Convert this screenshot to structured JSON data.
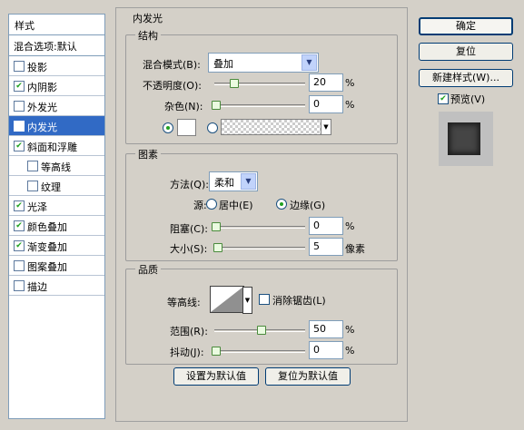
{
  "sidebar": {
    "header": "样式",
    "blend": "混合选项:默认",
    "items": [
      {
        "label": "投影",
        "checked": false,
        "selected": false
      },
      {
        "label": "内阴影",
        "checked": true,
        "selected": false
      },
      {
        "label": "外发光",
        "checked": false,
        "selected": false
      },
      {
        "label": "内发光",
        "checked": true,
        "selected": true
      },
      {
        "label": "斜面和浮雕",
        "checked": true,
        "selected": false
      },
      {
        "label": "等高线",
        "checked": false,
        "selected": false
      },
      {
        "label": "纹理",
        "checked": false,
        "selected": false
      },
      {
        "label": "光泽",
        "checked": true,
        "selected": false
      },
      {
        "label": "颜色叠加",
        "checked": true,
        "selected": false
      },
      {
        "label": "渐变叠加",
        "checked": true,
        "selected": false
      },
      {
        "label": "图案叠加",
        "checked": false,
        "selected": false
      },
      {
        "label": "描边",
        "checked": false,
        "selected": false
      }
    ]
  },
  "main": {
    "title": "内发光",
    "structure": {
      "title": "结构",
      "blend_mode_label": "混合模式(B):",
      "blend_mode_value": "叠加",
      "opacity_label": "不透明度(O):",
      "opacity_value": "20",
      "opacity_fraction": 0.2,
      "noise_label": "杂色(N):",
      "noise_value": "0",
      "noise_fraction": 0.0,
      "unit": "%"
    },
    "elements": {
      "title": "图素",
      "method_label": "方法(Q):",
      "method_value": "柔和",
      "source_label": "源:",
      "source_center": "居中(E)",
      "source_edge": "边缘(G)",
      "choke_label": "阻塞(C):",
      "choke_value": "0",
      "choke_fraction": 0.0,
      "size_label": "大小(S):",
      "size_value": "5",
      "size_fraction": 0.02,
      "pct": "%",
      "px": "像素"
    },
    "quality": {
      "title": "品质",
      "contour_label": "等高线:",
      "antialias_label": "消除锯齿(L)",
      "range_label": "范围(R):",
      "range_value": "50",
      "range_fraction": 0.5,
      "jitter_label": "抖动(J):",
      "jitter_value": "0",
      "jitter_fraction": 0.0,
      "unit": "%"
    },
    "default_button": "设置为默认值",
    "reset_default_button": "复位为默认值"
  },
  "right": {
    "ok": "确定",
    "reset": "复位",
    "new_style": "新建样式(W)...",
    "preview_label": "预览(V)",
    "preview_checked": true
  }
}
